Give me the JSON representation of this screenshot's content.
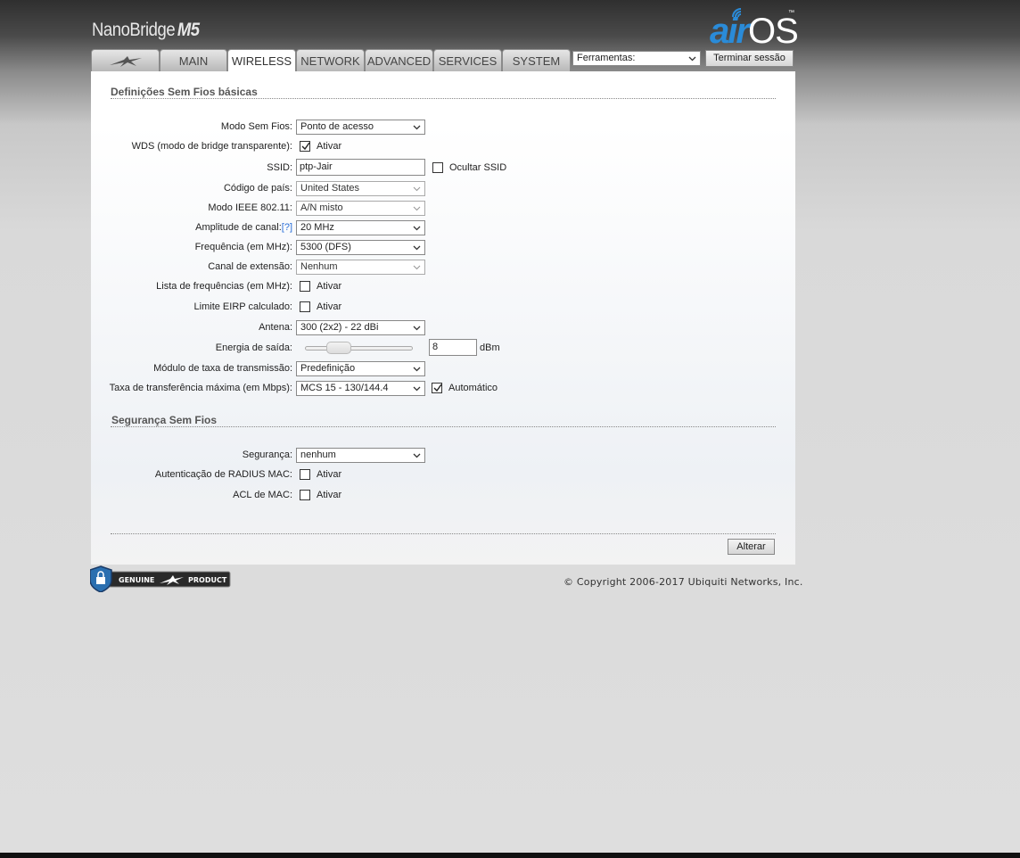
{
  "header": {
    "brand": "NanoBridge",
    "model": "M5",
    "logo_air": "air",
    "logo_os": "OS",
    "logo_tm": "™"
  },
  "tabs": [
    {
      "label": "",
      "icon": "ubiquiti-logo-icon"
    },
    {
      "label": "MAIN"
    },
    {
      "label": "WIRELESS",
      "active": true
    },
    {
      "label": "NETWORK"
    },
    {
      "label": "ADVANCED"
    },
    {
      "label": "SERVICES"
    },
    {
      "label": "SYSTEM"
    }
  ],
  "toolbar": {
    "tools_value": "Ferramentas:",
    "logout_label": "Terminar sessão"
  },
  "basic": {
    "title": "Definições Sem Fios básicas",
    "wireless_mode_label": "Modo Sem Fios:",
    "wireless_mode_value": "Ponto de acesso",
    "wds_label": "WDS (modo de bridge transparente):",
    "wds_enable": "Ativar",
    "ssid_label": "SSID:",
    "ssid_value": "ptp-Jair",
    "hide_ssid": "Ocultar SSID",
    "country_label": "Código de país:",
    "country_value": "United States",
    "ieee_label": "Modo IEEE 802.11:",
    "ieee_value": "A/N misto",
    "channel_width_label": "Amplitude de canal:",
    "channel_width_help": "[?]",
    "channel_width_value": "20 MHz",
    "frequency_label": "Frequência (em MHz):",
    "frequency_value": "5300 (DFS)",
    "extension_label": "Canal de extensão:",
    "extension_value": "Nenhum",
    "freq_list_label": "Lista de frequências (em MHz):",
    "freq_list_enable": "Ativar",
    "eirp_label": "Limite EIRP calculado:",
    "eirp_enable": "Ativar",
    "antenna_label": "Antena:",
    "antenna_value": "300 (2x2) - 22 dBi",
    "power_label": "Energia de saída:",
    "power_value": "8",
    "power_unit": "dBm",
    "power_level": 0.26,
    "rate_module_label": "Módulo de taxa de transmissão:",
    "rate_module_value": "Predefinição",
    "max_rate_label": "Taxa de transferência máxima (em Mbps):",
    "max_rate_value": "MCS 15 - 130/144.4",
    "auto_label": "Automático"
  },
  "security": {
    "title": "Segurança Sem Fios",
    "security_label": "Segurança:",
    "security_value": "nenhum",
    "radius_label": "Autenticação de RADIUS MAC:",
    "radius_enable": "Ativar",
    "acl_label": "ACL de MAC:",
    "acl_enable": "Ativar"
  },
  "apply_label": "Alterar",
  "footer": {
    "genuine_left": "GENUINE",
    "genuine_right": "PRODUCT",
    "copyright": "© Copyright 2006-2017 Ubiquiti Networks, Inc."
  }
}
